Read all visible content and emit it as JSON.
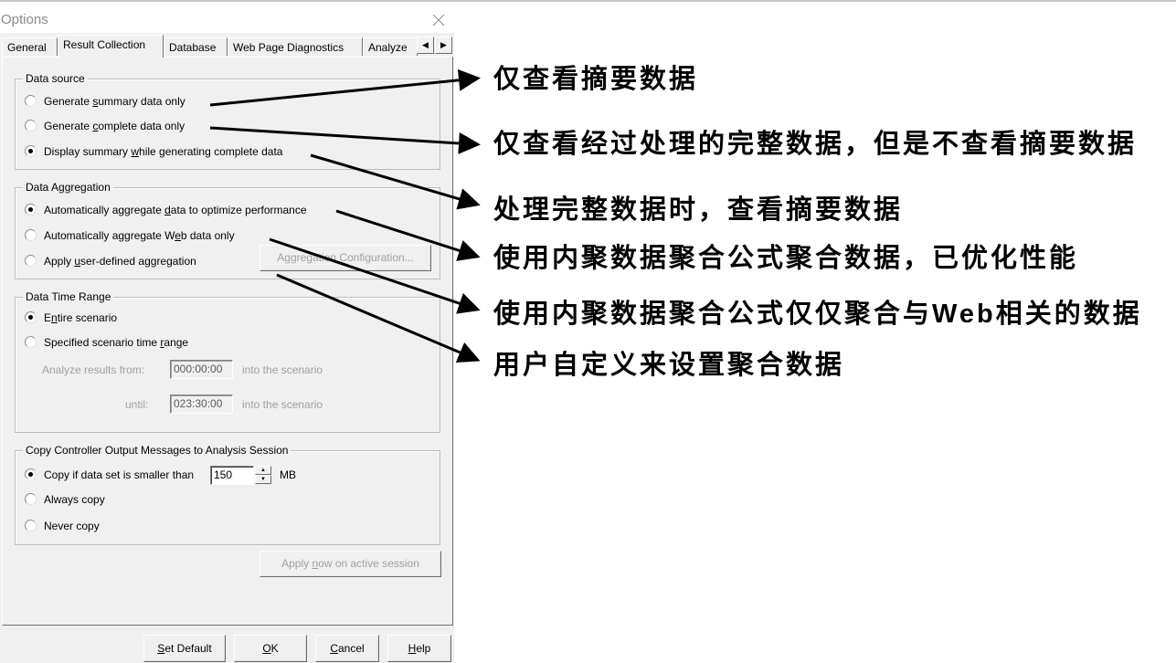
{
  "window": {
    "title": "Options",
    "close_icon": "close-icon"
  },
  "tabs": [
    {
      "label": "General",
      "active": false
    },
    {
      "label": "Result Collection",
      "active": true
    },
    {
      "label": "Database",
      "active": false
    },
    {
      "label": "Web Page Diagnostics",
      "active": false
    },
    {
      "label": "Analyze",
      "active": false
    }
  ],
  "tab_scroll": {
    "left": "◀",
    "right": "▶"
  },
  "data_source": {
    "label": "Data source",
    "options": [
      {
        "pre": "Generate ",
        "u": "s",
        "post": "ummary data only",
        "selected": false
      },
      {
        "pre": "Generate ",
        "u": "c",
        "post": "omplete data only",
        "selected": false
      },
      {
        "pre": "Display summary ",
        "u": "w",
        "post": "hile generating complete data",
        "selected": true
      }
    ]
  },
  "data_aggregation": {
    "label": "Data Aggregation",
    "options": [
      {
        "pre": "Automatically aggregate ",
        "u": "d",
        "post": "ata to optimize performance",
        "selected": true
      },
      {
        "pre": "Automatically aggregate W",
        "u": "e",
        "post": "b data only",
        "selected": false
      },
      {
        "pre": "Apply ",
        "u": "u",
        "post": "ser-defined aggregation",
        "selected": false
      }
    ],
    "config_button": "Aggregation Configuration..."
  },
  "data_time_range": {
    "label": "Data Time Range",
    "options": [
      {
        "pre": "E",
        "u": "n",
        "post": "tire scenario",
        "selected": true
      },
      {
        "pre": "Specified scenario time ",
        "u": "r",
        "post": "ange",
        "selected": false
      }
    ],
    "from_label": "Analyze results from:",
    "from_value": "000:00:00",
    "until_label": "until:",
    "until_value": "023:30:00",
    "suffix": "into the scenario"
  },
  "copy_output": {
    "label": "Copy Controller Output Messages to Analysis Session",
    "options": [
      {
        "label": "Copy if data set is smaller than",
        "selected": true
      },
      {
        "label": "Always copy",
        "selected": false
      },
      {
        "label": "Never copy",
        "selected": false
      }
    ],
    "size_value": "150",
    "unit": "MB",
    "apply_button": {
      "pre": "Apply ",
      "u": "n",
      "post": "ow on active session"
    }
  },
  "footer_buttons": [
    {
      "u": "S",
      "post": "et Default"
    },
    {
      "u": "O",
      "post": "K"
    },
    {
      "u": "C",
      "post": "ancel"
    },
    {
      "u": "H",
      "post": "elp"
    }
  ],
  "annotations": [
    "仅查看摘要数据",
    "仅查看经过处理的完整数据，但是不查看摘要数据",
    "处理完整数据时，查看摘要数据",
    "使用内聚数据聚合公式聚合数据，已优化性能",
    "使用内聚数据聚合公式仅仅聚合与Web相关的数据",
    "用户自定义来设置聚合数据"
  ]
}
